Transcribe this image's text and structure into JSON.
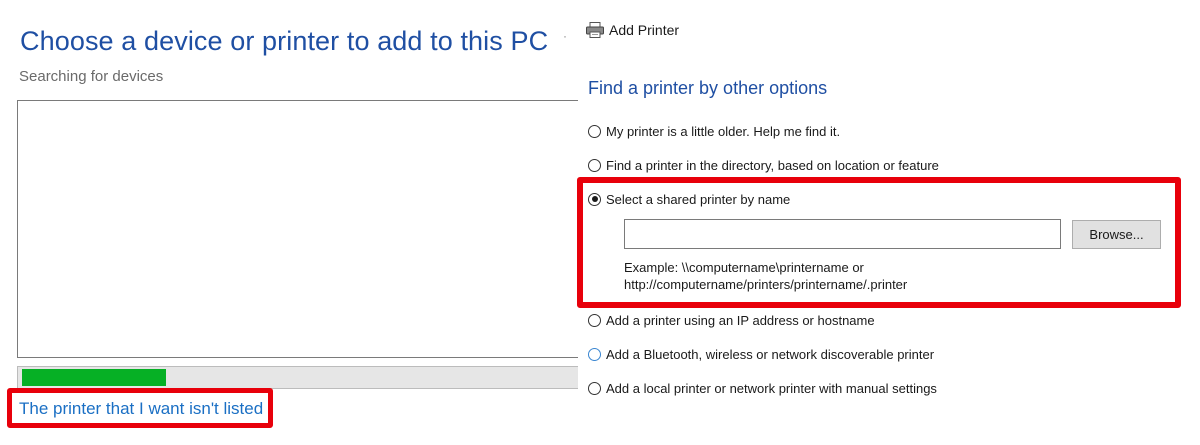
{
  "left": {
    "title": "Choose a device or printer to add to this PC",
    "status": "Searching for devices",
    "progress_fraction": 0.26,
    "not_listed_link": "The printer that I want isn't listed"
  },
  "right": {
    "header_title": "Add Printer",
    "section_title": "Find a printer by other options",
    "options": [
      {
        "label": "My printer is a little older. Help me find it.",
        "selected": false
      },
      {
        "label": "Find a printer in the directory, based on location or feature",
        "selected": false
      },
      {
        "label": "Select a shared printer by name",
        "selected": true
      },
      {
        "label": "Add a printer using an IP address or hostname",
        "selected": false
      },
      {
        "label": "Add a Bluetooth, wireless or network discoverable printer",
        "selected": false
      },
      {
        "label": "Add a local printer or network printer with manual settings",
        "selected": false
      }
    ],
    "shared_name_input": {
      "value": "",
      "placeholder": ""
    },
    "browse_label": "Browse...",
    "example_line1": "Example: \\\\computername\\printername or",
    "example_line2": "http://computername/printers/printername/.printer"
  },
  "colors": {
    "heading_blue": "#1f4fa3",
    "link_blue": "#1a6fc4",
    "progress_green": "#06b025",
    "highlight_red": "#e8000b"
  },
  "icons": {
    "header_icon": "printer-icon"
  }
}
